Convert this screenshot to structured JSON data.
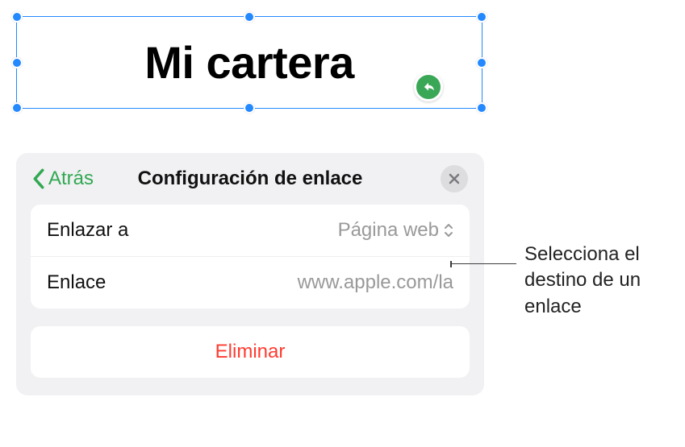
{
  "selection": {
    "text": "Mi cartera"
  },
  "popover": {
    "back_label": "Atrás",
    "title": "Configuración de enlace",
    "rows": {
      "link_to": {
        "label": "Enlazar a",
        "value": "Página web"
      },
      "link": {
        "label": "Enlace",
        "value": "www.apple.com/la"
      }
    },
    "delete_label": "Eliminar"
  },
  "callout": {
    "text": "Selecciona el destino de un enlace"
  }
}
